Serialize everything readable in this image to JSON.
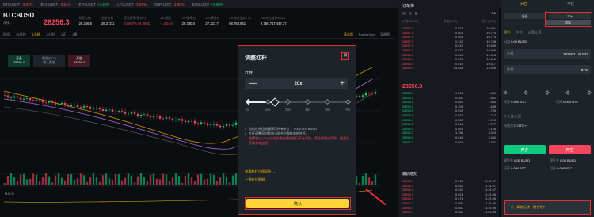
{
  "ticker": [
    {
      "sym": "BTCUSDT",
      "chg": "-3.32%"
    },
    {
      "sym": "BCHUSDT",
      "chg": "-3.64%"
    },
    {
      "sym": "ETHUSDT",
      "chg": "+4.26%"
    },
    {
      "sym": "LTCUSDT",
      "chg": "-3.34%"
    },
    {
      "sym": "XRPUSDT",
      "chg": "-1.80%"
    },
    {
      "sym": "EOSUSDT",
      "chg": "+4.50%"
    }
  ],
  "symbol": {
    "name": "BTCBUSD",
    "sub": "永续",
    "price": "28256.3",
    "stats": [
      {
        "k": "标记价格",
        "v": "28,256.6"
      },
      {
        "k": "指数价格",
        "v": "28,272.1"
      },
      {
        "k": "资金费率/倒计时",
        "v": "0.0067%  04:28:02"
      },
      {
        "k": "24h涨跌",
        "v": "-1,034.0"
      },
      {
        "k": "24h最高价",
        "v": "29,430.0"
      },
      {
        "k": "24h最低价",
        "v": "27,321.7"
      },
      {
        "k": "24h成交量(BTC)",
        "v": "98,758.941"
      },
      {
        "k": "24h成交额(BUSD)",
        "v": "2,758,717,447.37"
      }
    ]
  },
  "chart": {
    "intervals": [
      "时间",
      "15分钟",
      "1小时",
      "4小时",
      "1天",
      "1周"
    ],
    "views": [
      "基本版",
      "TradingView",
      "深度图"
    ],
    "mini_buy": {
      "label": "开多",
      "value": "28256.4"
    },
    "mini_qty": {
      "label": "数量(BTC)",
      "value": "输入数量"
    },
    "mini_sell": {
      "label": "开空",
      "value": "28256.3"
    }
  },
  "modal": {
    "title": "调整杠杆",
    "close": "✕",
    "leverage_label": "杠杆",
    "minus": "—",
    "value": "20x",
    "plus": "+",
    "slider_percent": 27,
    "ticks": [
      "1x",
      "15x",
      "30x",
      "45x",
      "60x",
      "75x"
    ],
    "note1": "当前杠杆倍数最高可持有头寸：7,000,000 BUSD",
    "note2": "杠杆调整同时影响当前合约和挂单的杠杆。",
    "warn": "选择超过 [10x] 杠杆交易会增加强行平仓风险。请注意相关风险，更多信息请参考这里。",
    "link1": "查看杠杆与保证金 →",
    "link2": "上调仓位限制 →",
    "confirm": "确认"
  },
  "orderbook": {
    "title": "订单簿",
    "step": "0.1",
    "headers": [
      "价格(BUSD)",
      "数量(BTC)",
      "合计(BTC)"
    ],
    "asks": [
      [
        "28257.9",
        "0.027",
        "19.801"
      ],
      [
        "28257.8",
        "0.001",
        "19.774"
      ],
      [
        "28257.5",
        "0.005",
        "19.773"
      ],
      [
        "28257.3",
        "0.119",
        "19.768"
      ],
      [
        "28257.0",
        "0.013",
        "19.649"
      ],
      [
        "28256.9",
        "0.023",
        "19.636"
      ],
      [
        "28256.8",
        "0.001",
        "19.613"
      ],
      [
        "28256.7",
        "0.095",
        "19.612"
      ],
      [
        "28256.5",
        "0.015",
        "19.517"
      ],
      [
        "28256.4",
        "14.528",
        "14.528"
      ]
    ],
    "mid": "28256.3",
    "bids": [
      [
        "28256.3",
        "1.331",
        "1.331"
      ],
      [
        "28256.2",
        "0.200",
        "1.531"
      ],
      [
        "28256.1",
        "0.053",
        "1.584"
      ],
      [
        "28256.0",
        "0.104",
        "1.688"
      ],
      [
        "28255.8",
        "0.018",
        "1.706"
      ],
      [
        "28255.6",
        "0.007",
        "1.713"
      ],
      [
        "28255.4",
        "0.300",
        "2.013"
      ],
      [
        "28255.1",
        "0.064",
        "2.077"
      ],
      [
        "28254.9",
        "0.051",
        "2.128"
      ],
      [
        "28254.7",
        "1.196",
        "3.324"
      ],
      [
        "28254.6",
        "0.016",
        "3.340"
      ],
      [
        "28254.3",
        "0.001",
        "3.341"
      ]
    ],
    "trades_title": "最新成交",
    "trades": [
      [
        "28256.3",
        "0.013",
        "11:21:07"
      ],
      [
        "28256.3",
        "0.002",
        "11:21:07"
      ],
      [
        "28256.3",
        "0.010",
        "11:21:07"
      ],
      [
        "28256.4",
        "0.001",
        "11:21:06"
      ],
      [
        "28256.3",
        "0.471",
        "11:21:06"
      ],
      [
        "28256.3",
        "0.006",
        "11:21:06"
      ],
      [
        "28256.4",
        "0.050",
        "11:21:05"
      ],
      [
        "28256.3",
        "0.020",
        "11:21:05"
      ]
    ]
  },
  "panel": {
    "tabs": [
      "开仓",
      "平仓"
    ],
    "mode": "全仓",
    "leverage": "20x",
    "order_tabs": [
      "限价",
      "市价",
      "止盈止损"
    ],
    "balance_label": "可用",
    "balance": "0.00 BUSD",
    "price_label": "价格",
    "price": "28256.3",
    "price_unit": "BUSD",
    "qty_label": "数量",
    "qty_unit": "BTC",
    "buy_can_label": "可开",
    "buy_can": "0.000 BTC",
    "sell_can_label": "可开",
    "sell_can": "0.000 BTC",
    "tpsl_label": "止盈/止损",
    "tif_label": "有效方式",
    "tif": "GTC",
    "buy": "开多",
    "sell": "开空",
    "margin_label": "保证金",
    "margin_buy": "0.00 BUSD",
    "margin_sell": "0.00 BUSD",
    "max_label": "可开",
    "max_buy": "0.000 BTC",
    "max_sell": "0.000 BTC",
    "promo": "如何玩转一期合约?"
  },
  "colors": {
    "up": "#0ecb81",
    "down": "#f6465d",
    "accent": "#f0b90b",
    "highlight": "#e0302f"
  }
}
